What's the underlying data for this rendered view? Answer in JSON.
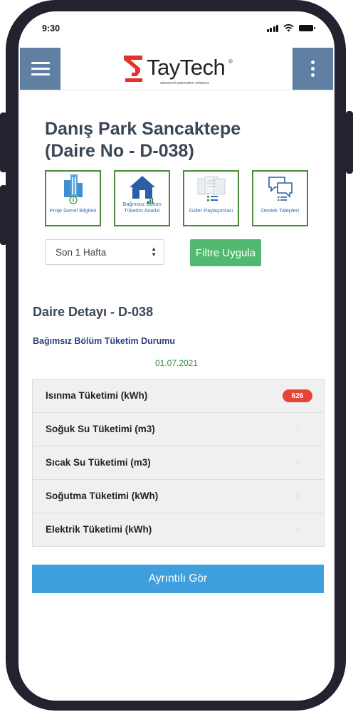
{
  "status_bar": {
    "time": "9:30"
  },
  "header": {
    "brand": "TayTech",
    "brand_mark": "®",
    "tagline": "advanced automation solutions",
    "brand_color": "#e4322b",
    "accent_color": "#5f7fa3"
  },
  "page": {
    "title_line1": "Danış Park Sancaktepe",
    "title_line2": "(Daire No - D-038)"
  },
  "tiles": [
    {
      "label": "Proje Genel Bilgileri",
      "icon": "building-info-icon"
    },
    {
      "label": "Bağımsız Bölüm Tüketim Analizi",
      "icon": "house-icon"
    },
    {
      "label": "Gider Paylaşımları",
      "icon": "document-list-icon"
    },
    {
      "label": "Destek Talepleri",
      "icon": "chat-icon"
    }
  ],
  "filter": {
    "period_value": "Son 1 Hafta",
    "apply_label": "Filtre Uygula"
  },
  "detail": {
    "title": "Daire Detayı - D-038",
    "subtitle": "Bağımsız Bölüm Tüketim Durumu",
    "date": "01.07.2021",
    "items": [
      {
        "label": "Isınma Tüketimi (kWh)",
        "value": "626",
        "status": "alert"
      },
      {
        "label": "Soğuk Su Tüketimi (m3)",
        "value": "0",
        "status": "zero"
      },
      {
        "label": "Sıcak Su Tüketimi (m3)",
        "value": "0",
        "status": "zero"
      },
      {
        "label": "Soğutma Tüketimi (kWh)",
        "value": "0",
        "status": "zero"
      },
      {
        "label": "Elektrik Tüketimi (kWh)",
        "value": "0",
        "status": "zero"
      }
    ],
    "details_button": "Ayrıntılı Gör"
  },
  "colors": {
    "tile_border": "#4a8a3a",
    "tile_label": "#2f6fb6",
    "filter_button": "#52b970",
    "details_button": "#3f9fdc",
    "alert_badge": "#e64437"
  }
}
